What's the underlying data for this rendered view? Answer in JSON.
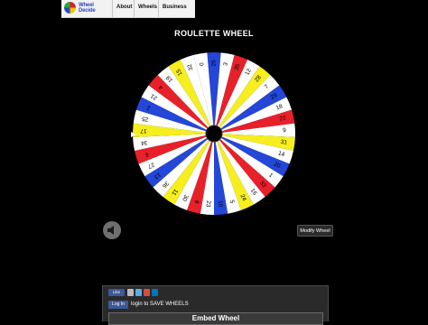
{
  "header": {
    "logo_text_1": "Wheel",
    "logo_text_2": "Decide",
    "nav": [
      "About",
      "Wheels",
      "Business"
    ]
  },
  "title": "ROULETTE WHEEL",
  "wheel": {
    "numbers": [
      "26",
      "3",
      "35",
      "12",
      "28",
      "7",
      "29",
      "18",
      "22",
      "9",
      "31",
      "14",
      "20",
      "1",
      "33",
      "16",
      "24",
      "5",
      "10",
      "23",
      "8",
      "30",
      "11",
      "36",
      "13",
      "27",
      "6",
      "34",
      "17",
      "25",
      "2",
      "21",
      "4",
      "19",
      "15",
      "32",
      "0"
    ],
    "colors": [
      "#2447d8",
      "#ffffff",
      "#e8202a",
      "#ffffff",
      "#f6ee1e",
      "#ffffff",
      "#2447d8",
      "#ffffff",
      "#e8202a",
      "#ffffff",
      "#f6ee1e",
      "#ffffff",
      "#2447d8",
      "#ffffff",
      "#e8202a",
      "#ffffff",
      "#f6ee1e",
      "#ffffff",
      "#2447d8",
      "#ffffff",
      "#e8202a",
      "#ffffff",
      "#f6ee1e",
      "#ffffff",
      "#2447d8",
      "#ffffff",
      "#e8202a",
      "#ffffff",
      "#f6ee1e",
      "#ffffff",
      "#2447d8",
      "#ffffff",
      "#e8202a",
      "#ffffff",
      "#f6ee1e",
      "#ffffff",
      "#ffffff"
    ],
    "hub_color": "#000000"
  },
  "controls": {
    "sound_icon": "speaker-icon",
    "modify_label": "Modify Wheel"
  },
  "bottom": {
    "like_label": "Like",
    "login_button": "Log In",
    "login_text": "login to SAVE WHEELS",
    "embed_label": "Embed Wheel"
  }
}
